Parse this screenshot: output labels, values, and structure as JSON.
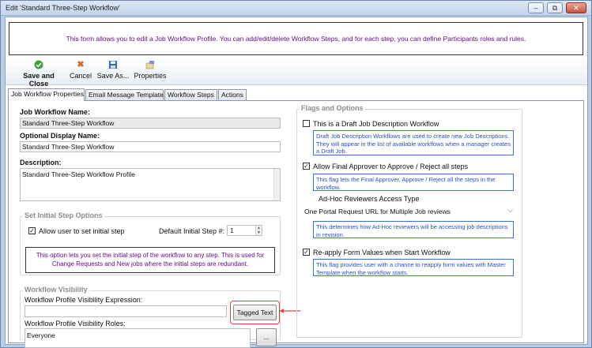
{
  "window": {
    "title": "Edit 'Standard Three-Step Workflow'",
    "minimize_label": "–",
    "restore_label": "⧉",
    "close_label": "✕"
  },
  "banner": {
    "text": "This form allows you to edit a Job Workflow Profile. You can add/edit/delete Workflow Steps, and for each step, you can define Participants roles and rules."
  },
  "toolbar": {
    "save_close_label": "Save and Close",
    "cancel_label": "Cancel",
    "save_as_label": "Save As...",
    "properties_label": "Properties"
  },
  "tabs": [
    {
      "label": "Job Workflow Properties",
      "active": true
    },
    {
      "label": "Email Message Template",
      "active": false
    },
    {
      "label": "Workflow Steps",
      "active": false
    },
    {
      "label": "Actions",
      "active": false
    }
  ],
  "form": {
    "name_label": "Job Workflow Name:",
    "name_value": "Standard Three-Step Workflow",
    "display_label": "Optional Display Name:",
    "display_value": "Standard Three-Step Workflow",
    "description_label": "Description:",
    "description_value": "Standard Three-Step Workflow Profile"
  },
  "initial_step": {
    "group_title": "Set Initial Step Options",
    "allow_label": "Allow user to set initial step",
    "allow_checked": true,
    "default_label": "Default Initial Step #:",
    "default_value": "1",
    "note": "This option lets you set the initial step of the workflow to any step.  This is used for Change Requests and New jobs where the initial steps are redundant."
  },
  "visibility": {
    "group_title": "Workflow Visibility",
    "expression_label": "Workflow Profile Visibility Expression:",
    "expression_value": "",
    "tagged_text_label": "Tagged Text",
    "roles_label": "Workflow Profile Visibility Roles:",
    "roles_value": "Everyone",
    "browse_label": "..."
  },
  "flags": {
    "group_title": "Flags and Options",
    "draft_label": "This is a Draft Job Description Workflow",
    "draft_checked": false,
    "draft_note": "Draft Job Description Workflows are used to create new Job Descriptions. They will appear in the list of available workflows when a manager creates a Draft Job.",
    "final_label": "Allow Final Approver to Approve / Reject all steps",
    "final_checked": true,
    "final_note": "This flag lets the Final Approver, Approve / Reject all the steps in the workflow.",
    "adhoc_title": "Ad-Hoc Reviewers Access Type",
    "adhoc_value": "One Portal Request URL for Multiple Job reviews",
    "adhoc_note": "This determines how Ad-Hoc reviewers will be accessing job descriptions in revision.",
    "reapply_label": "Re-apply Form Values when Start Workflow",
    "reapply_checked": true,
    "reapply_note": "This flag provides user with a chance to reapply form values with Master Template when the workflow starts."
  },
  "colors": {
    "accent_highlight": "#e0443c",
    "note_purple": "#6a0a8a",
    "note_blue": "#2b4fc9"
  }
}
